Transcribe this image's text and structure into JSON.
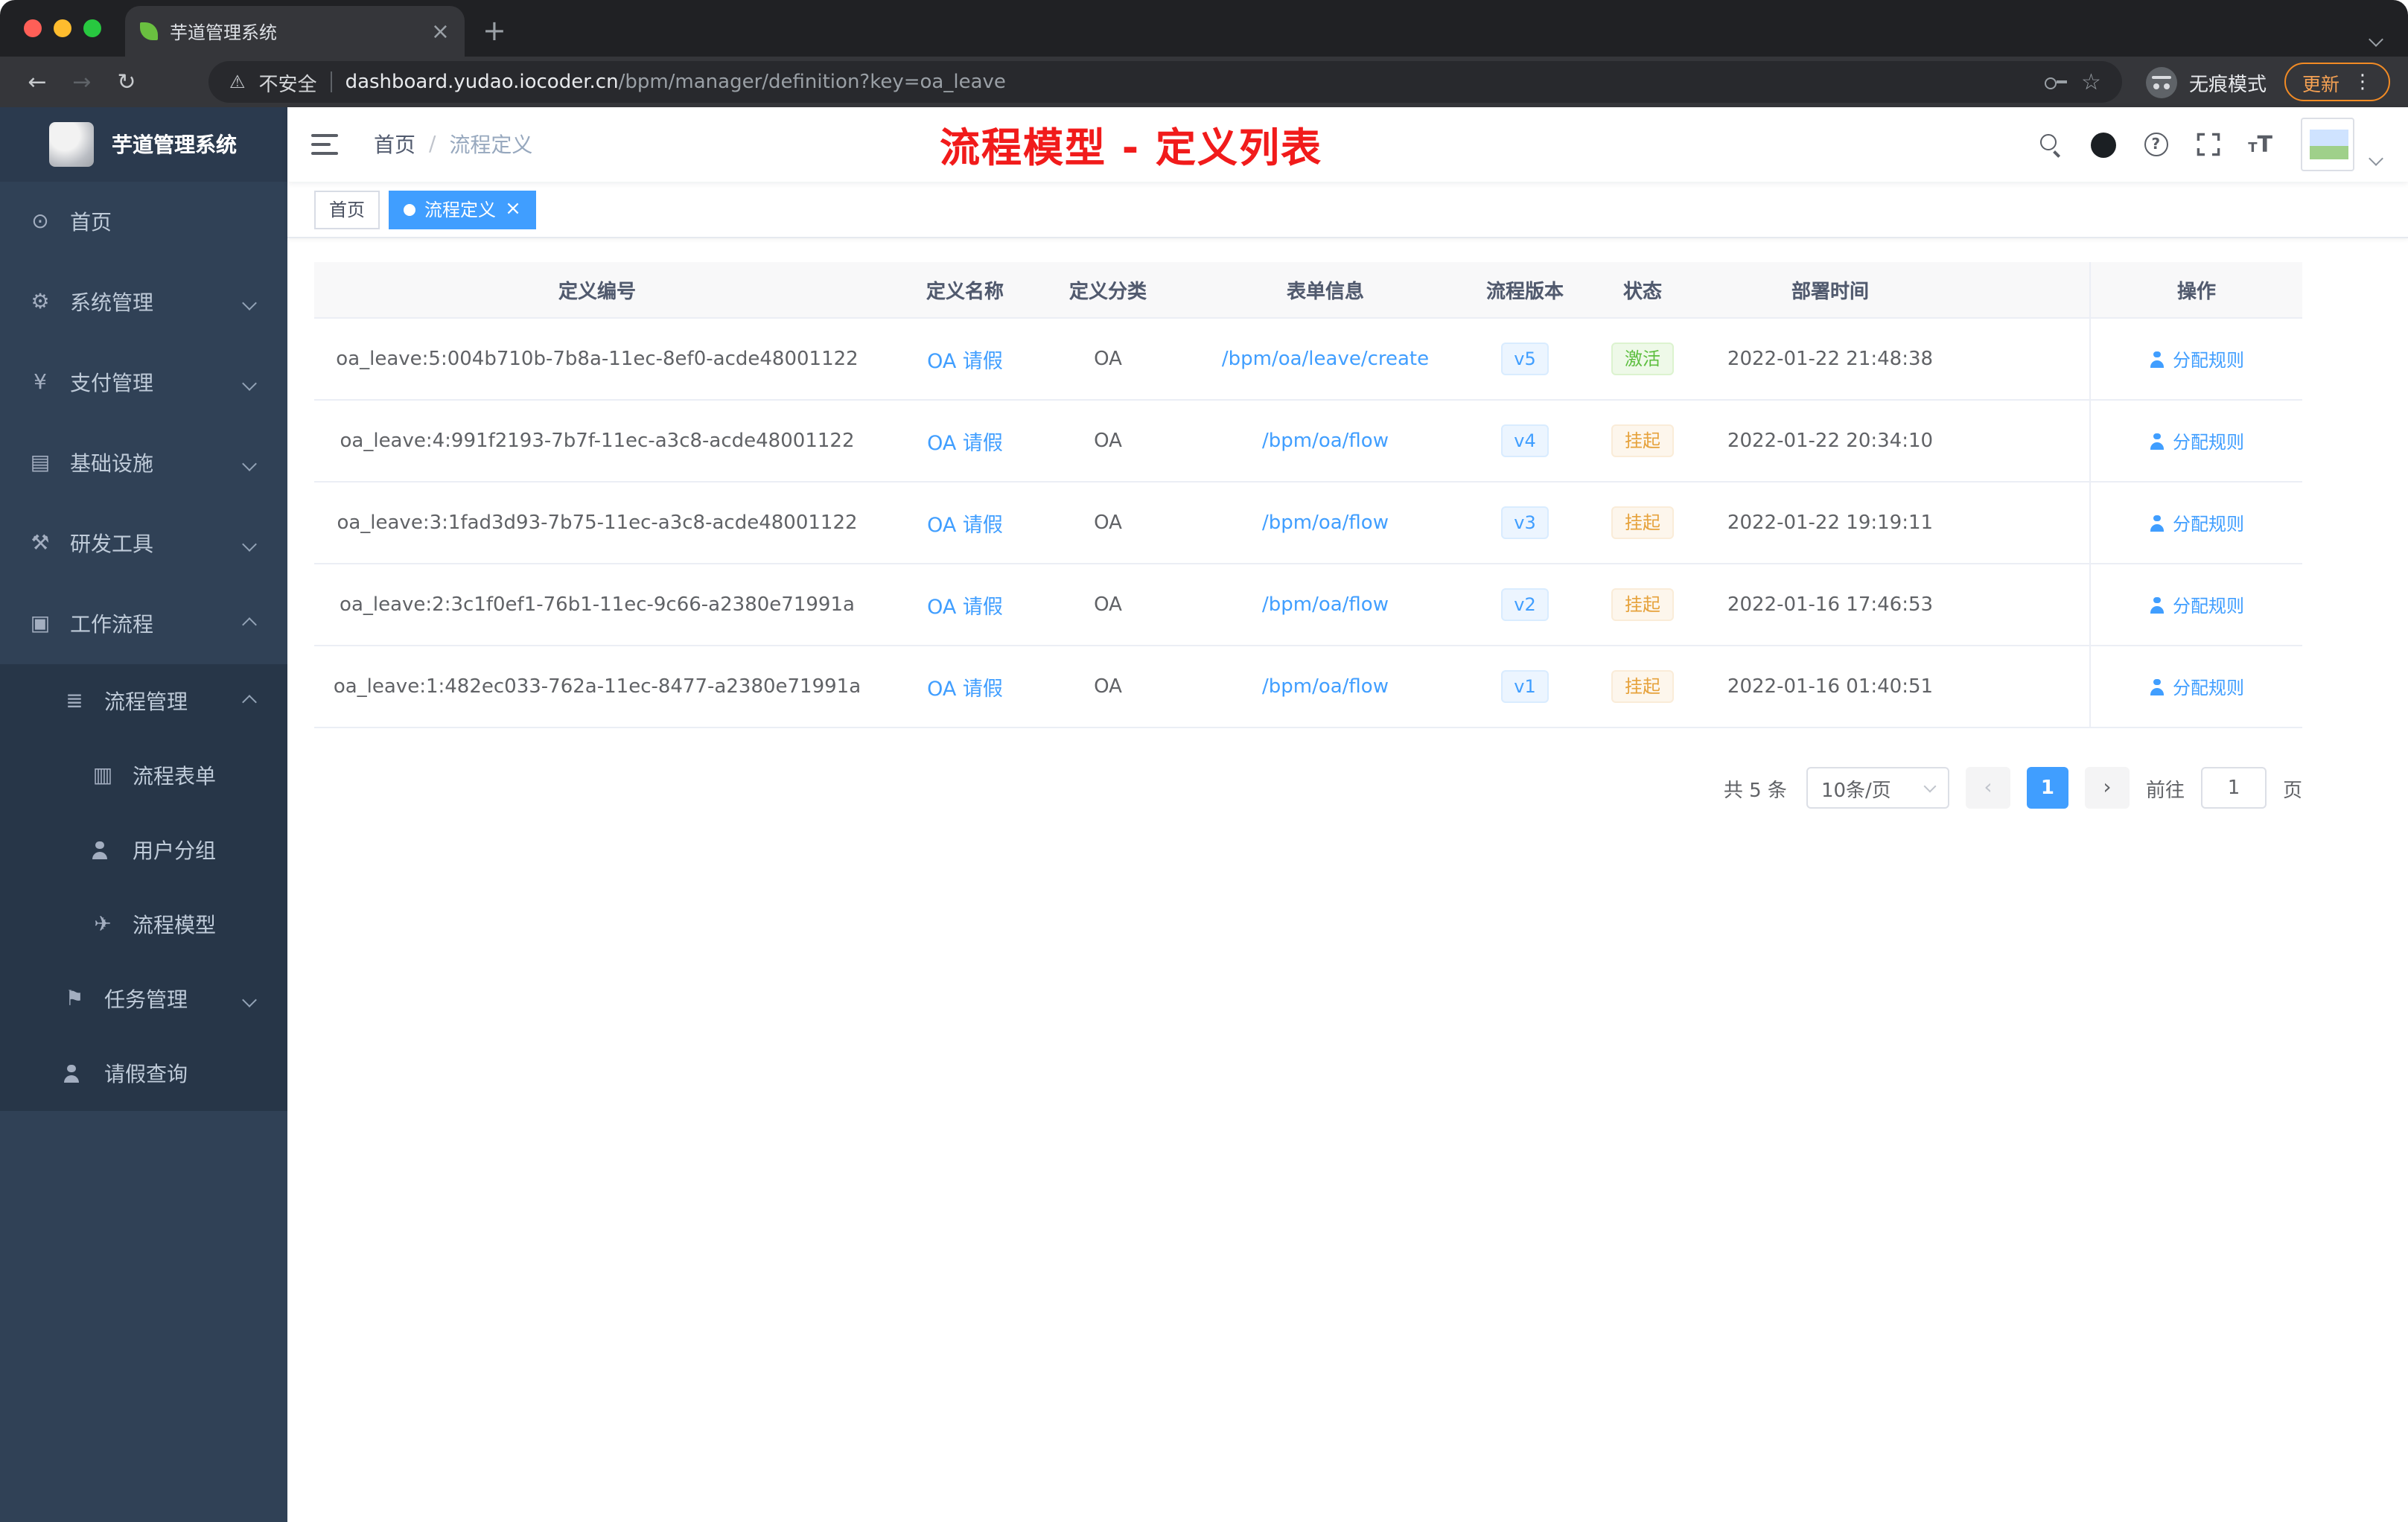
{
  "browser": {
    "tab_title": "芋道管理系统",
    "address": {
      "security": "不安全",
      "host": "dashboard.yudao.iocoder.cn",
      "path": "/bpm/manager/definition?key=oa_leave"
    },
    "incognito_label": "无痕模式",
    "update_label": "更新"
  },
  "sidebar": {
    "logo_title": "芋道管理系统",
    "menu": [
      {
        "label": "首页",
        "icon": "dashboard-icon",
        "level": 1,
        "chevron": "",
        "sub": false
      },
      {
        "label": "系统管理",
        "icon": "gear-icon",
        "level": 1,
        "chevron": "down",
        "sub": false
      },
      {
        "label": "支付管理",
        "icon": "payment-icon",
        "level": 1,
        "chevron": "down",
        "sub": false
      },
      {
        "label": "基础设施",
        "icon": "infrastructure-icon",
        "level": 1,
        "chevron": "down",
        "sub": false
      },
      {
        "label": "研发工具",
        "icon": "devtools-icon",
        "level": 1,
        "chevron": "down",
        "sub": false
      },
      {
        "label": "工作流程",
        "icon": "workflow-icon",
        "level": 1,
        "chevron": "up",
        "sub": false
      },
      {
        "label": "流程管理",
        "icon": "process-list-icon",
        "level": 2,
        "chevron": "up",
        "sub": true
      },
      {
        "label": "流程表单",
        "icon": "form-icon",
        "level": 3,
        "chevron": "",
        "sub": true
      },
      {
        "label": "用户分组",
        "icon": "user-group-icon",
        "level": 3,
        "chevron": "",
        "sub": true
      },
      {
        "label": "流程模型",
        "icon": "model-icon",
        "level": 3,
        "chevron": "",
        "sub": true
      },
      {
        "label": "任务管理",
        "icon": "task-icon",
        "level": 2,
        "chevron": "down",
        "sub": true
      },
      {
        "label": "请假查询",
        "icon": "user-icon",
        "level": 2,
        "chevron": "",
        "sub": true
      }
    ]
  },
  "header": {
    "breadcrumb": {
      "root": "首页",
      "separator": "/",
      "current": "流程定义"
    },
    "annotation": "流程模型 - 定义列表"
  },
  "tags": [
    {
      "label": "首页",
      "active": false,
      "closable": false
    },
    {
      "label": "流程定义",
      "active": true,
      "closable": true
    }
  ],
  "table": {
    "columns": [
      "定义编号",
      "定义名称",
      "定义分类",
      "表单信息",
      "流程版本",
      "状态",
      "部署时间",
      "操作"
    ],
    "action_label": "分配规则",
    "rows": [
      {
        "id": "oa_leave:5:004b710b-7b8a-11ec-8ef0-acde48001122",
        "name": "OA 请假",
        "category": "OA",
        "form": "/bpm/oa/leave/create",
        "version": "v5",
        "status": "激活",
        "status_type": "success",
        "deploy_time": "2022-01-22 21:48:38"
      },
      {
        "id": "oa_leave:4:991f2193-7b7f-11ec-a3c8-acde48001122",
        "name": "OA 请假",
        "category": "OA",
        "form": "/bpm/oa/flow",
        "version": "v4",
        "status": "挂起",
        "status_type": "warning",
        "deploy_time": "2022-01-22 20:34:10"
      },
      {
        "id": "oa_leave:3:1fad3d93-7b75-11ec-a3c8-acde48001122",
        "name": "OA 请假",
        "category": "OA",
        "form": "/bpm/oa/flow",
        "version": "v3",
        "status": "挂起",
        "status_type": "warning",
        "deploy_time": "2022-01-22 19:19:11"
      },
      {
        "id": "oa_leave:2:3c1f0ef1-76b1-11ec-9c66-a2380e71991a",
        "name": "OA 请假",
        "category": "OA",
        "form": "/bpm/oa/flow",
        "version": "v2",
        "status": "挂起",
        "status_type": "warning",
        "deploy_time": "2022-01-16 17:46:53"
      },
      {
        "id": "oa_leave:1:482ec033-762a-11ec-8477-a2380e71991a",
        "name": "OA 请假",
        "category": "OA",
        "form": "/bpm/oa/flow",
        "version": "v1",
        "status": "挂起",
        "status_type": "warning",
        "deploy_time": "2022-01-16 01:40:51"
      }
    ]
  },
  "pagination": {
    "total": "共 5 条",
    "page_size": "10条/页",
    "current_page": "1",
    "goto_label": "前往",
    "goto_value": "1",
    "page_unit": "页"
  },
  "colors": {
    "accent": "#409EFF",
    "success_text": "#5DBE3F",
    "warning_text": "#E6A23C",
    "annotation_red": "#F11B1B",
    "sidebar_bg": "#304156",
    "submenu_bg": "#273648"
  }
}
